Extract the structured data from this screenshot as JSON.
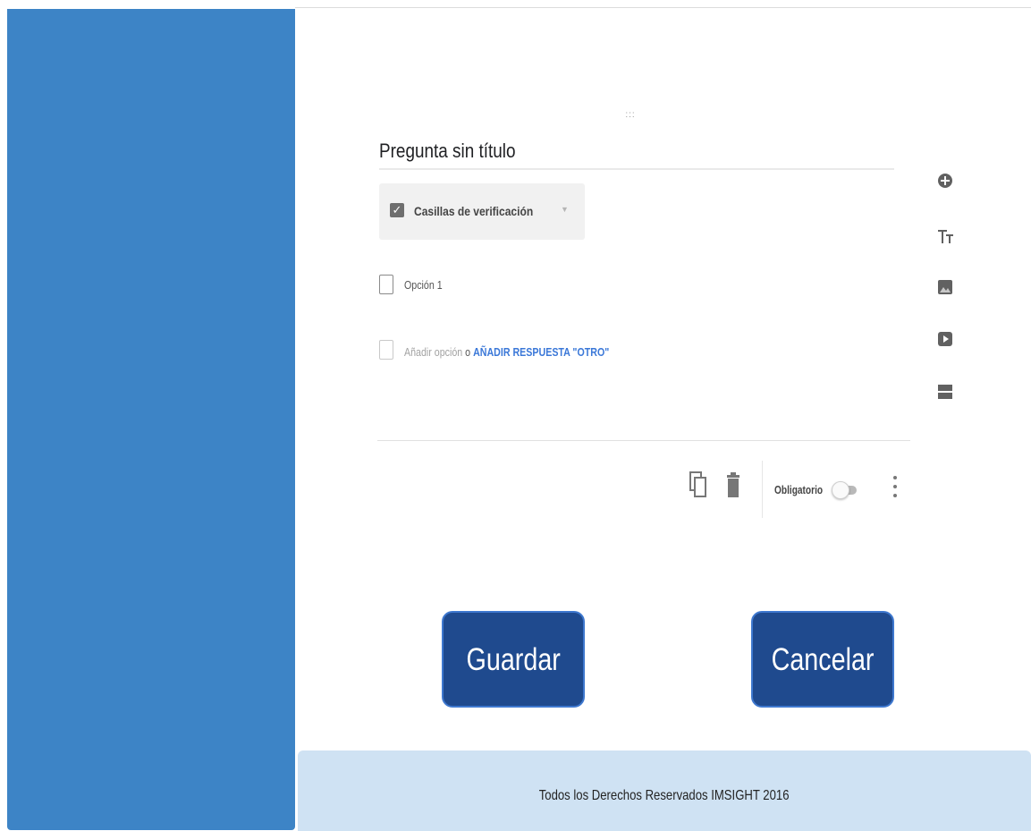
{
  "question": {
    "drag_handle": ":::",
    "title": "Pregunta sin título",
    "type_label": "Casillas de verificación",
    "type_icon": "checkbox-checked-icon",
    "options": [
      {
        "label": "Opción 1"
      }
    ],
    "add_option_label": "Añadir opción",
    "add_option_separator": "o",
    "add_other_label": "AÑADIR RESPUESTA \"OTRO\"",
    "required_label": "Obligatorio",
    "required_on": false
  },
  "toolbar_icons": [
    "copy-icon",
    "trash-icon",
    "more-vert-icon"
  ],
  "side_tools": [
    "add-question-icon",
    "text-title-icon",
    "image-icon",
    "video-icon",
    "section-icon"
  ],
  "actions": {
    "save_label": "Guardar",
    "cancel_label": "Cancelar"
  },
  "footer": {
    "text": "Todos los Derechos Reservados  IMSIGHT 2016"
  },
  "colors": {
    "sidebar": "#3d84c6",
    "button_bg": "#1f4a8e",
    "button_border": "#3e78cf",
    "link": "#3b78d8",
    "footer_bg": "#cfe2f3"
  }
}
